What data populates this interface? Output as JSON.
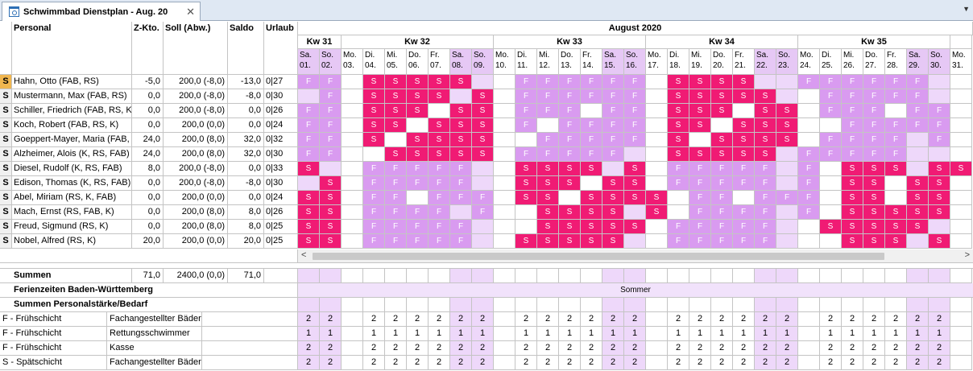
{
  "tab": {
    "title": "Schwimmbad Dienstplan - Aug. 20",
    "close": "✕"
  },
  "tabmenu": "▼",
  "headers": {
    "personal": "Personal",
    "zkto": "Z-Kto.",
    "soll": "Soll (Abw.)",
    "saldo": "Saldo",
    "urlaub": "Urlaub",
    "month": "August 2020"
  },
  "weeks": [
    {
      "label": "Kw 31",
      "days": 2
    },
    {
      "label": "Kw 32",
      "days": 7
    },
    {
      "label": "Kw 33",
      "days": 7
    },
    {
      "label": "Kw 34",
      "days": 7
    },
    {
      "label": "Kw 35",
      "days": 7
    },
    {
      "label": "",
      "days": 1
    }
  ],
  "days": [
    {
      "d": "Sa.",
      "n": "01.",
      "we": true
    },
    {
      "d": "So.",
      "n": "02.",
      "we": true
    },
    {
      "d": "Mo.",
      "n": "03.",
      "we": false
    },
    {
      "d": "Di.",
      "n": "04.",
      "we": false
    },
    {
      "d": "Mi.",
      "n": "05.",
      "we": false
    },
    {
      "d": "Do.",
      "n": "06.",
      "we": false
    },
    {
      "d": "Fr.",
      "n": "07.",
      "we": false
    },
    {
      "d": "Sa.",
      "n": "08.",
      "we": true
    },
    {
      "d": "So.",
      "n": "09.",
      "we": true
    },
    {
      "d": "Mo.",
      "n": "10.",
      "we": false
    },
    {
      "d": "Di.",
      "n": "11.",
      "we": false
    },
    {
      "d": "Mi.",
      "n": "12.",
      "we": false
    },
    {
      "d": "Do.",
      "n": "13.",
      "we": false
    },
    {
      "d": "Fr.",
      "n": "14.",
      "we": false
    },
    {
      "d": "Sa.",
      "n": "15.",
      "we": true
    },
    {
      "d": "So.",
      "n": "16.",
      "we": true
    },
    {
      "d": "Mo.",
      "n": "17.",
      "we": false
    },
    {
      "d": "Di.",
      "n": "18.",
      "we": false
    },
    {
      "d": "Mi.",
      "n": "19.",
      "we": false
    },
    {
      "d": "Do.",
      "n": "20.",
      "we": false
    },
    {
      "d": "Fr.",
      "n": "21.",
      "we": false
    },
    {
      "d": "Sa.",
      "n": "22.",
      "we": true
    },
    {
      "d": "So.",
      "n": "23.",
      "we": true
    },
    {
      "d": "Mo.",
      "n": "24.",
      "we": false
    },
    {
      "d": "Di.",
      "n": "25.",
      "we": false
    },
    {
      "d": "Mi.",
      "n": "26.",
      "we": false
    },
    {
      "d": "Do.",
      "n": "27.",
      "we": false
    },
    {
      "d": "Fr.",
      "n": "28.",
      "we": false
    },
    {
      "d": "Sa.",
      "n": "29.",
      "we": true
    },
    {
      "d": "So.",
      "n": "30.",
      "we": true
    },
    {
      "d": "Mo.",
      "n": "31.",
      "we": false
    }
  ],
  "employees": [
    {
      "badge": "S",
      "selected": true,
      "name": "Hahn, Otto (FAB, RS)",
      "zkto": "-5,0",
      "soll": "200,0 (-8,0)",
      "saldo": "-13,0",
      "urlaub": "0|27",
      "shifts": "FF.SSSSS..FFFFFF.SSSS..FFFFFF."
    },
    {
      "badge": "S",
      "selected": false,
      "name": "Mustermann, Max (FAB, RS)",
      "zkto": "0,0",
      "soll": "200,0 (-8,0)",
      "saldo": "-8,0",
      "urlaub": "0|30",
      "shifts": ".F.SSSS.S.FFFFFF.SSSSS..FFFFF."
    },
    {
      "badge": "S",
      "selected": false,
      "name": "Schiller, Friedrich (FAB, RS, K)",
      "zkto": "0,0",
      "soll": "200,0 (-8,0)",
      "saldo": "0,0",
      "urlaub": "0|26",
      "shifts": "FF.SSS.SS.FFF.FF.SSS.SS.FFF.FF"
    },
    {
      "badge": "S",
      "selected": false,
      "name": "Koch, Robert (FAB, RS, K)",
      "zkto": "0,0",
      "soll": "200,0 (0,0)",
      "saldo": "0,0",
      "urlaub": "0|24",
      "shifts": "FF.SS.SSS.F.FFFF.SS.SSS..FFFFF"
    },
    {
      "badge": "S",
      "selected": false,
      "name": "Goeppert-Mayer, Maria (FAB,",
      "zkto": "24,0",
      "soll": "200,0 (8,0)",
      "saldo": "32,0",
      "urlaub": "0|32",
      "shifts": "FF.S.SSSS..FFFFF.S.SSSS.FFFF.F"
    },
    {
      "badge": "S",
      "selected": false,
      "name": "Alzheimer, Alois (K, RS, FAB)",
      "zkto": "24,0",
      "soll": "200,0 (8,0)",
      "saldo": "32,0",
      "urlaub": "0|30",
      "shifts": "FF..SSSSS.FFFFF..SSSSS.FFFFF.."
    },
    {
      "badge": "S",
      "selected": false,
      "name": "Diesel, Rudolf (K, RS, FAB)",
      "zkto": "8,0",
      "soll": "200,0 (-8,0)",
      "saldo": "0,0",
      "urlaub": "0|33",
      "shifts": "S..FFFFF..SSSS.S.FFFFF.F.SSS.SS"
    },
    {
      "badge": "S",
      "selected": false,
      "name": "Edison, Thomas (K, RS, FAB)",
      "zkto": "0,0",
      "soll": "200,0 (-8,0)",
      "saldo": "-8,0",
      "urlaub": "0|30",
      "shifts": ".S.FFFFF..SSS.SS.FFFFF.F.SS.SS."
    },
    {
      "badge": "S",
      "selected": false,
      "name": "Abel, Miriam (RS, K, FAB)",
      "zkto": "0,0",
      "soll": "200,0 (0,0)",
      "saldo": "0,0",
      "urlaub": "0|24",
      "shifts": "SS.FF.FFF.SS.SSSS.FF.FFF.SS.SS."
    },
    {
      "badge": "S",
      "selected": false,
      "name": "Mach, Ernst (RS, FAB, K)",
      "zkto": "0,0",
      "soll": "200,0 (8,0)",
      "saldo": "8,0",
      "urlaub": "0|26",
      "shifts": "SS.FFFF.F..SSSS.S.FFFF.F.SSSSS."
    },
    {
      "badge": "S",
      "selected": false,
      "name": "Freud, Sigmund (RS, K)",
      "zkto": "0,0",
      "soll": "200,0 (8,0)",
      "saldo": "8,0",
      "urlaub": "0|25",
      "shifts": "SS.FFFFF...SSSSS.FFFFF..SSSSS."
    },
    {
      "badge": "S",
      "selected": false,
      "name": "Nobel, Alfred (RS, K)",
      "zkto": "20,0",
      "soll": "200,0 (0,0)",
      "saldo": "20,0",
      "urlaub": "0|25",
      "shifts": "SS.FFFFF..SSSSS..FFFFF...SSS.S."
    }
  ],
  "scroll": {
    "left": "<",
    "right": ">"
  },
  "summen": {
    "label": "Summen",
    "zkto": "71,0",
    "soll": "2400,0 (0,0)",
    "saldo": "71,0"
  },
  "ferien": {
    "label": "Ferienzeiten Baden-Württemberg",
    "value": "Sommer"
  },
  "personalstaerke": {
    "label": "Summen Personalstärke/Bedarf"
  },
  "bedarf": [
    {
      "shift": "F - Frühschicht",
      "role": "Fachangestellter Bäderb",
      "value": "2"
    },
    {
      "shift": "F - Frühschicht",
      "role": "Rettungsschwimmer",
      "value": "1"
    },
    {
      "shift": "F - Frühschicht",
      "role": "Kasse",
      "value": "2"
    },
    {
      "shift": "S - Spätschicht",
      "role": "Fachangestellter Bäderb",
      "value": "2"
    }
  ],
  "colors": {
    "spaet": "#f01b74",
    "frueh": "#d99bf0",
    "weekend": "#e6c8f5",
    "selected": "#f0b64f"
  }
}
